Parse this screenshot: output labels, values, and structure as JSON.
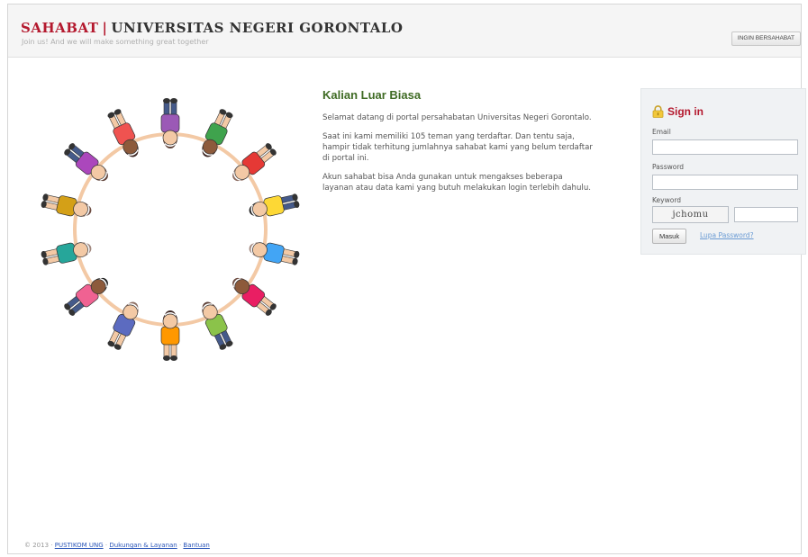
{
  "header": {
    "brand": "SAHABAT",
    "separator": "|",
    "university": "UNIVERSITAS NEGERI GORONTALO",
    "tagline": "Join us! And we will make something great together",
    "action_button": "INGIN BERSAHABAT"
  },
  "content": {
    "heading": "Kalian Luar Biasa",
    "paragraphs": [
      "Selamat datang di portal persahabatan Universitas Negeri Gorontalo.",
      "Saat ini kami memiliki 105 teman yang terdaftar. Dan tentu saja, hampir tidak terhitung jumlahnya sahabat kami yang belum terdaftar di portal ini.",
      "Akun sahabat bisa Anda gunakan untuk mengakses beberapa layanan atau data kami yang butuh melakukan login terlebih dahulu."
    ]
  },
  "signin": {
    "title": "Sign in",
    "email_label": "Email",
    "email_value": "",
    "password_label": "Password",
    "password_value": "",
    "keyword_label": "Keyword",
    "captcha_text": "jchomu",
    "keyword_value": "",
    "submit_label": "Masuk",
    "forgot_label": "Lupa Password?"
  },
  "footer": {
    "copyright": "© 2013 ·",
    "link1": "PUSTIKOM UNG",
    "sep1": " · ",
    "link2": "Dukungan & Layanan",
    "sep2": " · ",
    "link3": "Bantuan"
  },
  "icons": {
    "lock": "lock-icon",
    "illustration": "children-circle-illustration"
  },
  "colors": {
    "brand_red": "#b4192e",
    "heading_green": "#3f6b24",
    "link_blue": "#2b56b8",
    "signin_bg": "#f0f2f4"
  }
}
